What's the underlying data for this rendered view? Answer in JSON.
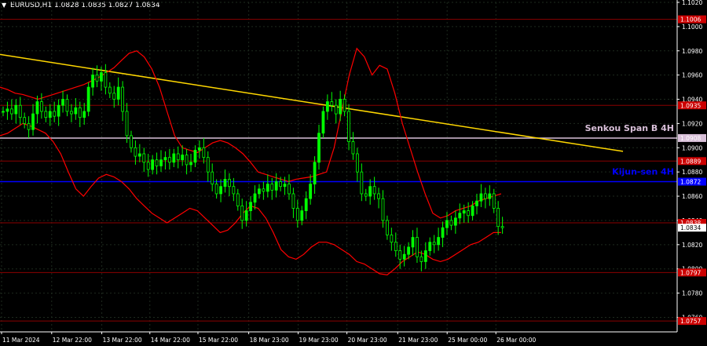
{
  "header": {
    "symbol": "EURUSD,H1",
    "ohlc": "1.0828 1.0835 1.0827 1.0834",
    "menu_icon": "triangle-down-icon"
  },
  "chart_data": {
    "type": "candlestick",
    "ylim": [
      1.0748,
      1.102
    ],
    "y_ticks": [
      1.102,
      1.1,
      1.098,
      1.096,
      1.094,
      1.092,
      1.09,
      1.088,
      1.086,
      1.084,
      1.082,
      1.08,
      1.078,
      1.076
    ],
    "x_tick_labels": [
      "11 Mar 2024",
      "12 Mar 22:00",
      "13 Mar 22:00",
      "14 Mar 22:00",
      "15 Mar 22:00",
      "18 Mar 23:00",
      "19 Mar 23:00",
      "20 Mar 23:00",
      "21 Mar 23:00",
      "25 Mar 00:00",
      "26 Mar 00:00"
    ],
    "x_tick_positions": [
      0.0,
      0.074,
      0.148,
      0.219,
      0.29,
      0.365,
      0.438,
      0.51,
      0.585,
      0.658,
      0.73
    ],
    "grid": true,
    "colors": {
      "background": "#000000",
      "up_candle": "#00ff00",
      "down_candle": "#00ff00",
      "ichimoku_cloud": "#ff0000",
      "trendline": "#ffd700",
      "senkou_line": "#d8bfd8",
      "kijun_line": "#0000ff",
      "resistance_lines": "#8b0000",
      "grid": "#1e2a1e",
      "axis_text": "#ffffff"
    },
    "horizontal_levels": [
      {
        "price": 1.1006,
        "label": "1.1006",
        "color": "#8b0000"
      },
      {
        "price": 1.0935,
        "label": "1.0935",
        "color": "#8b0000"
      },
      {
        "price": 1.0908,
        "label": "1.0908",
        "color": "#d8bfd8",
        "name": "Senkou Span B 4H"
      },
      {
        "price": 1.0889,
        "label": "1.0889",
        "color": "#8b0000"
      },
      {
        "price": 1.0872,
        "label": "1.0872",
        "color": "#0000ff",
        "name": "Kijun-sen 4H"
      },
      {
        "price": 1.0838,
        "label": "1.0838",
        "color": "#8b0000"
      },
      {
        "price": 1.0797,
        "label": "1.0797",
        "color": "#8b0000"
      },
      {
        "price": 1.0757,
        "label": "1.0757",
        "color": "#8b0000"
      }
    ],
    "current_price": {
      "price": 1.0834,
      "label": "1.0834"
    },
    "trendline": {
      "start_price": 1.0977,
      "end_price": 1.0897,
      "start_frac": 0.0,
      "end_frac": 0.92
    },
    "close_series": [
      1.093,
      1.0932,
      1.0928,
      1.0935,
      1.0925,
      1.092,
      1.0915,
      1.0928,
      1.0938,
      1.093,
      1.0925,
      1.093,
      1.0926,
      1.0935,
      1.094,
      1.093,
      1.0928,
      1.0933,
      1.0925,
      1.093,
      1.095,
      1.096,
      1.0955,
      1.0962,
      1.095,
      1.0945,
      1.094,
      1.095,
      1.093,
      1.091,
      1.09,
      1.0893,
      1.0895,
      1.0888,
      1.0882,
      1.089,
      1.0885,
      1.089,
      1.0892,
      1.0888,
      1.0895,
      1.089,
      1.0894,
      1.0886,
      1.0888,
      1.0898,
      1.09,
      1.0892,
      1.088,
      1.087,
      1.0862,
      1.0868,
      1.0874,
      1.0868,
      1.0862,
      1.0852,
      1.084,
      1.0848,
      1.0855,
      1.0862,
      1.0866,
      1.0864,
      1.087,
      1.0865,
      1.0872,
      1.0868,
      1.087,
      1.0862,
      1.085,
      1.084,
      1.0848,
      1.0858,
      1.087,
      1.0888,
      1.0912,
      1.093,
      1.0938,
      1.0935,
      1.0928,
      1.094,
      1.093,
      1.0905,
      1.0895,
      1.088,
      1.0862,
      1.086,
      1.0868,
      1.0862,
      1.0858,
      1.084,
      1.0828,
      1.0822,
      1.0815,
      1.0808,
      1.0812,
      1.0818,
      1.0826,
      1.081,
      1.0806,
      1.0815,
      1.0822,
      1.082,
      1.0826,
      1.0834,
      1.084,
      1.0836,
      1.0842,
      1.0846,
      1.0848,
      1.0844,
      1.0852,
      1.0856,
      1.0862,
      1.0858,
      1.0862,
      1.085,
      1.0835,
      1.0834
    ],
    "cloud_upper": [
      1.095,
      1.0948,
      1.0945,
      1.0944,
      1.0942,
      1.094,
      1.0942,
      1.0944,
      1.0946,
      1.0948,
      1.095,
      1.0952,
      1.0955,
      1.0958,
      1.0962,
      1.0966,
      1.0972,
      1.0978,
      1.098,
      1.0975,
      1.0965,
      1.095,
      1.093,
      1.091,
      1.09,
      1.0898,
      1.0896,
      1.09,
      1.0904,
      1.0906,
      1.0904,
      1.09,
      1.0895,
      1.0888,
      1.088,
      1.0878,
      1.0876,
      1.0874,
      1.0872,
      1.0874,
      1.0875,
      1.0876,
      1.0878,
      1.088,
      1.09,
      1.093,
      1.096,
      1.0982,
      1.0975,
      1.096,
      1.0968,
      1.0965,
      1.0945,
      1.092,
      1.09,
      1.088,
      1.0862,
      1.0846,
      1.0842,
      1.0844,
      1.0848,
      1.085,
      1.0852,
      1.0856,
      1.0858,
      1.086,
      1.0862
    ],
    "cloud_lower": [
      1.091,
      1.0912,
      1.0916,
      1.092,
      1.0918,
      1.0915,
      1.0912,
      1.0905,
      1.0895,
      1.088,
      1.0866,
      1.086,
      1.0868,
      1.0875,
      1.0878,
      1.0876,
      1.0872,
      1.0866,
      1.0858,
      1.0852,
      1.0846,
      1.0842,
      1.0838,
      1.0842,
      1.0846,
      1.085,
      1.0848,
      1.0842,
      1.0836,
      1.083,
      1.0832,
      1.0838,
      1.0846,
      1.0852,
      1.085,
      1.0842,
      1.083,
      1.0816,
      1.081,
      1.0808,
      1.0812,
      1.0818,
      1.0822,
      1.0822,
      1.082,
      1.0816,
      1.0812,
      1.0806,
      1.0804,
      1.08,
      1.0796,
      1.0795,
      1.08,
      1.0806,
      1.081,
      1.0814,
      1.0812,
      1.0808,
      1.0806,
      1.0808,
      1.0812,
      1.0816,
      1.082,
      1.0822,
      1.0826,
      1.083,
      1.083
    ],
    "annotations": [
      {
        "text": "Senkou Span B 4H",
        "price": 1.0908,
        "color": "#d8bfd8"
      },
      {
        "text": "Kijun-sen 4H",
        "price": 1.0872,
        "color": "#0000ff"
      }
    ]
  }
}
